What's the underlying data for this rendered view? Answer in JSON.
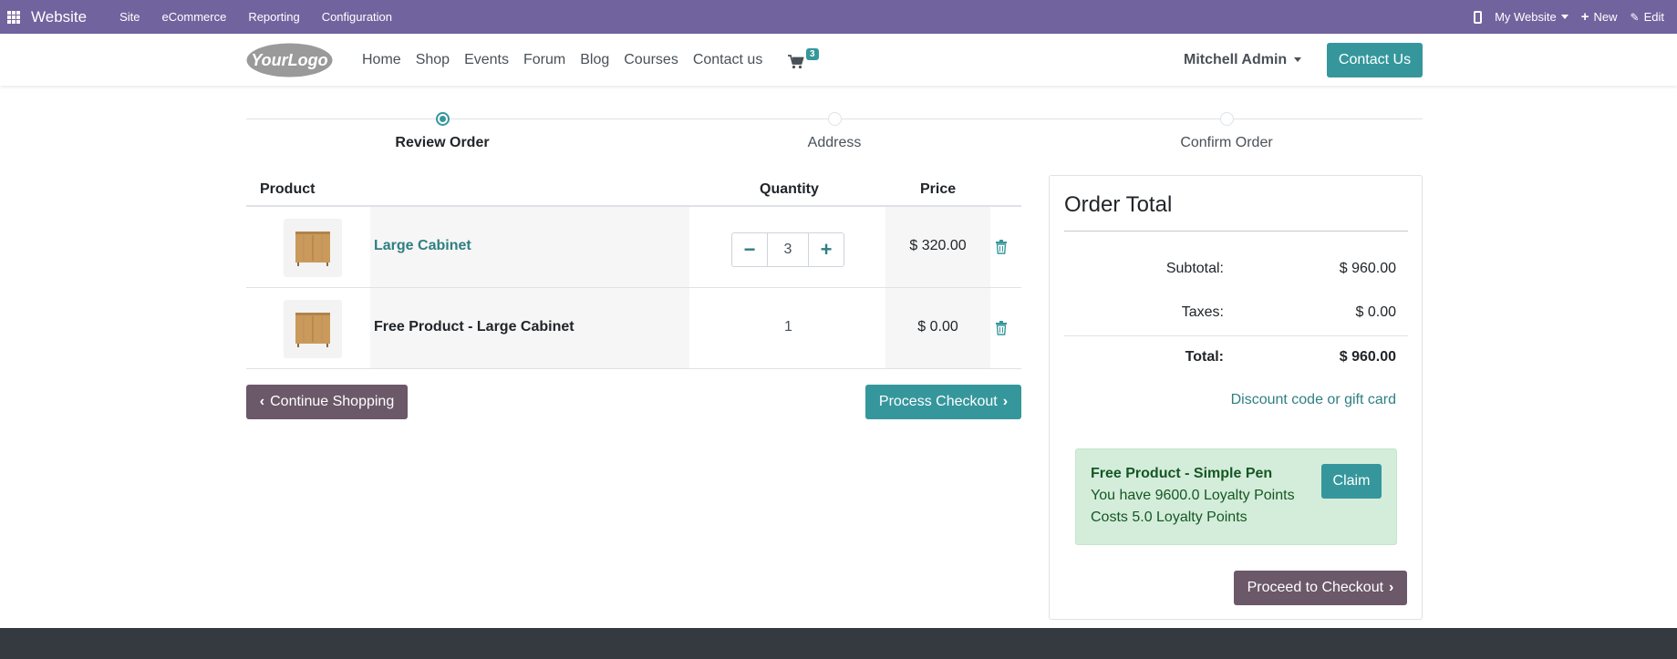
{
  "topbar": {
    "app_name": "Website",
    "menu": [
      "Site",
      "eCommerce",
      "Reporting",
      "Configuration"
    ],
    "website_selector": "My Website",
    "new_label": "New",
    "edit_label": "Edit",
    "bg_color": "#71639e"
  },
  "header": {
    "logo_text": "YourLogo",
    "nav": [
      "Home",
      "Shop",
      "Events",
      "Forum",
      "Blog",
      "Courses",
      "Contact us"
    ],
    "cart_count": "3",
    "user_name": "Mitchell Admin",
    "contact_button": "Contact Us"
  },
  "wizard": {
    "steps": [
      {
        "label": "Review Order",
        "active": true
      },
      {
        "label": "Address",
        "active": false
      },
      {
        "label": "Confirm Order",
        "active": false
      }
    ]
  },
  "cart": {
    "headers": {
      "product": "Product",
      "quantity": "Quantity",
      "price": "Price"
    },
    "lines": [
      {
        "name": "Large Cabinet",
        "quantity": "3",
        "price": "$ 320.00",
        "editable": true
      },
      {
        "name": "Free Product - Large Cabinet",
        "quantity": "1",
        "price": "$ 0.00",
        "editable": false
      }
    ],
    "continue_label": "Continue Shopping",
    "process_label": "Process Checkout"
  },
  "order_total": {
    "title": "Order Total",
    "subtotal_label": "Subtotal:",
    "subtotal_value": "$ 960.00",
    "taxes_label": "Taxes:",
    "taxes_value": "$ 0.00",
    "total_label": "Total:",
    "total_value": "$ 960.00",
    "discount_link": "Discount code or gift card",
    "reward": {
      "title": "Free Product - Simple Pen",
      "points_line": "You have 9600.0 Loyalty Points",
      "cost_line": "Costs 5.0 Loyalty Points",
      "claim_label": "Claim"
    },
    "proceed_label": "Proceed to Checkout"
  },
  "colors": {
    "accent": "#35979c",
    "secondary": "#6b5869",
    "link": "#2f7f83",
    "footer": "#353a40"
  }
}
